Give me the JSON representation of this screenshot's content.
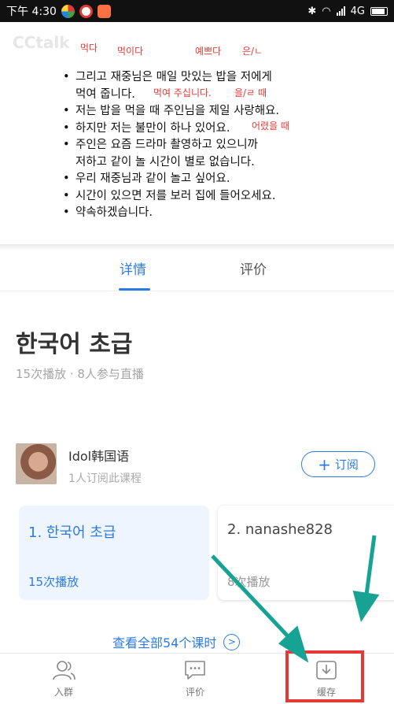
{
  "status_bar": {
    "time": "下午 4:30",
    "network": "4G"
  },
  "slide": {
    "watermark": "CCtalk",
    "notes": {
      "n1": "먹다",
      "n2": "먹이다",
      "n3": "예쁘다",
      "n4": "은/ㄴ",
      "n5": "먹여 주십니다.",
      "n6": "을/ㄹ 때",
      "n7": "어렸을 때"
    },
    "lines": [
      "그리고 재중님은 매일 맛있는 밥을 저에게",
      "먹여 줍니다.",
      "저는 밥을 먹을 때 주인님을 제일 사랑해요.",
      "하지만 저는 불만이 하나 있어요.",
      "주인은 요즘 드라마 촬영하고 있으니까",
      "저하고  같이 놀 시간이 별로 없습니다.",
      "우리 재중님과 같이 놀고 싶어요.",
      "시간이 있으면 저를 보러 집에 들어오세요.",
      "약속하겠습니다."
    ]
  },
  "tabs": {
    "details": "详情",
    "reviews": "评价"
  },
  "course": {
    "title": "한국어 초급",
    "meta": "15次播放 · 8人参与直播"
  },
  "teacher": {
    "name": "Idol韩国语",
    "subscribers": "1人订阅此课程",
    "subscribe_label": "订阅"
  },
  "lessons": [
    {
      "title": "1. 한국어 초급",
      "plays": "15次播放"
    },
    {
      "title": "2. nanashe828",
      "plays": "8次播放"
    }
  ],
  "view_all": "查看全部54个课时",
  "bottom_bar": {
    "group": "入群",
    "review": "评价",
    "cache": "缓存"
  },
  "colors": {
    "accent": "#2c7be5",
    "annotation_box": "#e53935",
    "annotation_arrow": "#16a393"
  }
}
